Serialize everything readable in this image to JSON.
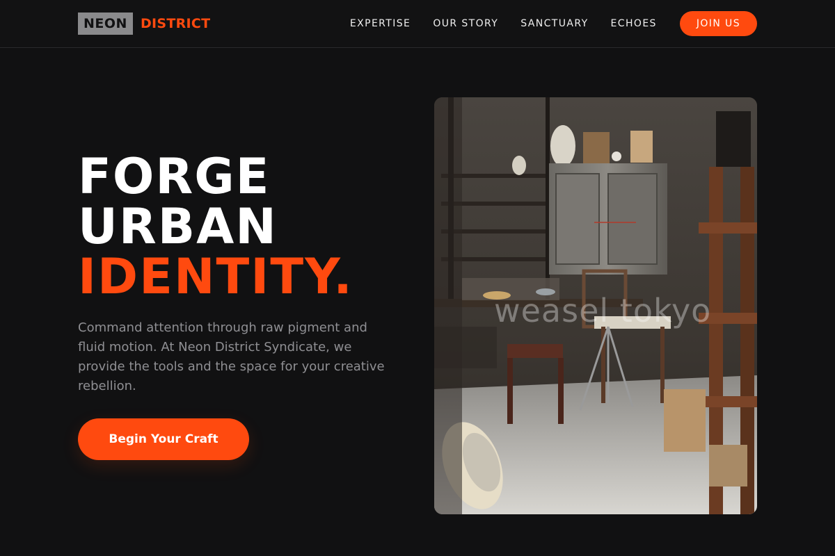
{
  "brand": {
    "part1": "NEON",
    "part2": "DISTRICT"
  },
  "nav": {
    "links": [
      "EXPERTISE",
      "OUR STORY",
      "SANCTUARY",
      "ECHOES"
    ],
    "cta": "JOIN US"
  },
  "hero": {
    "title_line1": "FORGE",
    "title_line2": "URBAN",
    "title_line3": "IDENTITY.",
    "description": "Command attention through raw pigment and fluid motion. At Neon District Syndicate, we provide the tools and the space for your creative rebellion.",
    "cta": "Begin Your Craft",
    "image_watermark": "weasel tokyo"
  },
  "colors": {
    "accent": "#ff4a0f",
    "background": "#111112",
    "muted_text": "#8f8f93"
  }
}
